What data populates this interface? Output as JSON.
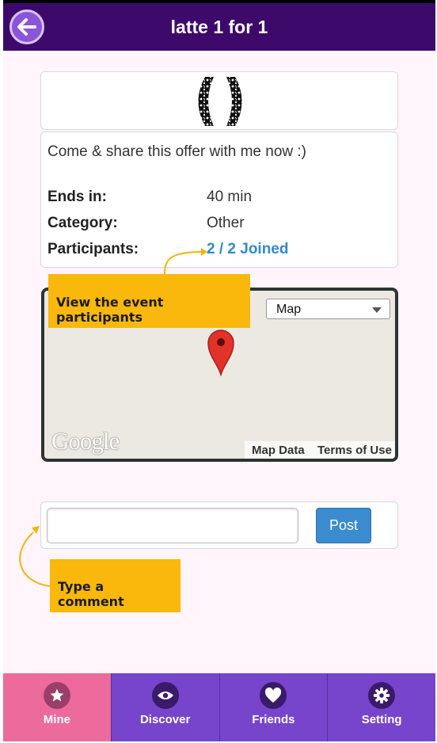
{
  "header": {
    "title": "latte 1 for 1",
    "back_icon": "arrow-left-icon"
  },
  "offer": {
    "description": "Come & share this offer with me now :)",
    "fields": [
      {
        "label": "Ends in:",
        "value": "40 min"
      },
      {
        "label": "Category:",
        "value": "Other"
      },
      {
        "label": "Participants:",
        "value": "2 / 2 Joined"
      }
    ]
  },
  "map": {
    "type_selected": "Map",
    "logo_text": "Google",
    "map_data_label": "Map Data",
    "terms_label": "Terms of Use"
  },
  "comment": {
    "placeholder": "",
    "post_label": "Post"
  },
  "callouts": {
    "participants": "View the event participants",
    "comment": "Type a comment"
  },
  "tabs": [
    {
      "label": "Mine",
      "icon": "star-icon",
      "active": true
    },
    {
      "label": "Discover",
      "icon": "eye-icon",
      "active": false
    },
    {
      "label": "Friends",
      "icon": "heart-icon",
      "active": false
    },
    {
      "label": "Setting",
      "icon": "gear-icon",
      "active": false
    }
  ],
  "colors": {
    "header": "#3d0a6b",
    "tab": "#7744cc",
    "tab_active": "#ec6a9c",
    "link": "#3388cc",
    "callout": "#f9b80b",
    "post_button": "#3a8bd0"
  }
}
